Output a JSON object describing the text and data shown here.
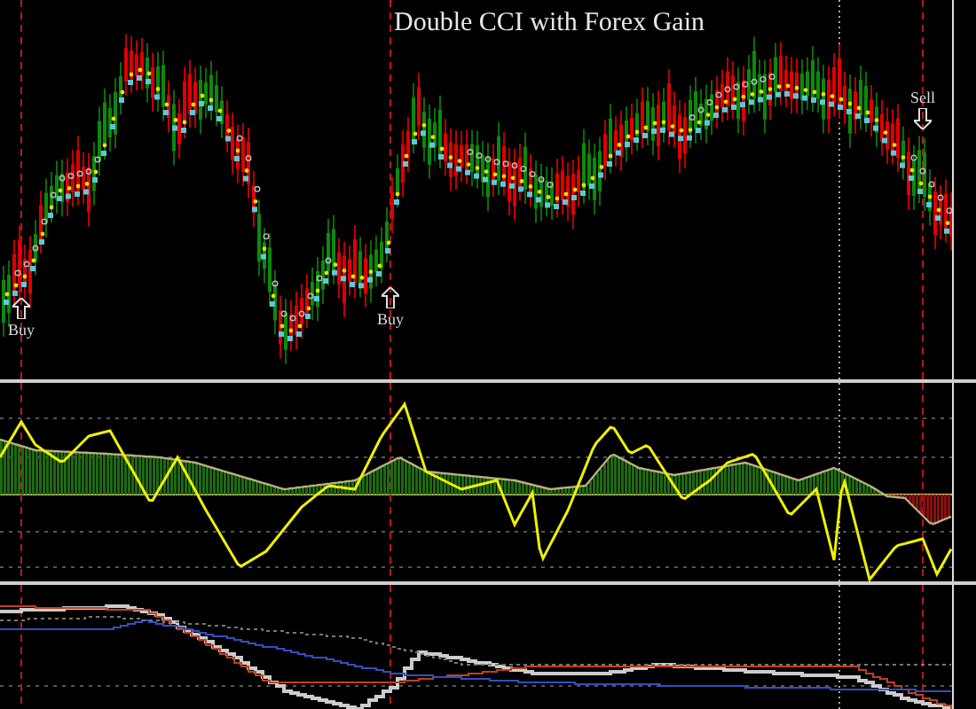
{
  "chart_title": "Double CCI with Forex Gain",
  "signals": [
    {
      "label": "Buy",
      "kind": "buy"
    },
    {
      "label": "Buy",
      "kind": "buy"
    },
    {
      "label": "Sell",
      "kind": "sell"
    }
  ]
}
